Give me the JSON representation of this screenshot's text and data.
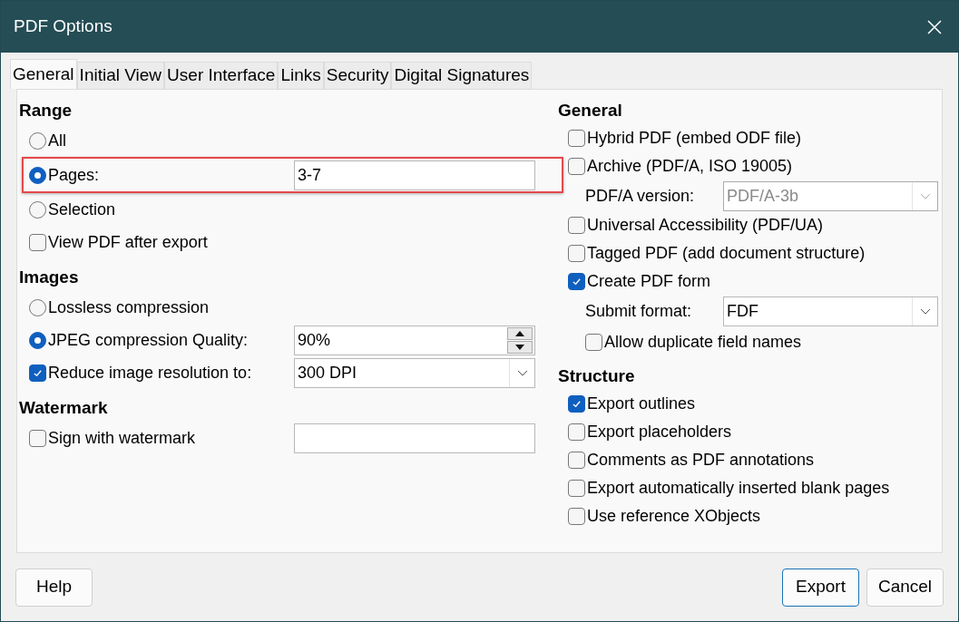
{
  "window": {
    "title": "PDF Options"
  },
  "tabs": [
    {
      "label": "General",
      "selected": true
    },
    {
      "label": "Initial View",
      "selected": false
    },
    {
      "label": "User Interface",
      "selected": false
    },
    {
      "label": "Links",
      "selected": false
    },
    {
      "label": "Security",
      "selected": false
    },
    {
      "label": "Digital Signatures",
      "selected": false
    }
  ],
  "left_sections": [
    {
      "heading": "Range",
      "items": [
        {
          "kind": "radio",
          "label": "All",
          "selected": false,
          "highlighted": false
        },
        {
          "kind": "radio",
          "label": "Pages:",
          "selected": true,
          "highlighted": true,
          "field": {
            "kind": "text",
            "value": "3-7",
            "disabled": false
          }
        },
        {
          "kind": "radio",
          "label": "Selection",
          "selected": false,
          "highlighted": false
        },
        {
          "kind": "checkbox",
          "label": "View PDF after export",
          "checked": false,
          "highlighted": false
        }
      ]
    },
    {
      "heading": "Images",
      "items": [
        {
          "kind": "radio",
          "label": "Lossless compression",
          "selected": false,
          "highlighted": false
        },
        {
          "kind": "radio",
          "label": "JPEG compression Quality:",
          "selected": true,
          "highlighted": false,
          "field": {
            "kind": "spin",
            "value": "90%",
            "disabled": false
          }
        },
        {
          "kind": "checkbox",
          "label": "Reduce image resolution to:",
          "checked": true,
          "highlighted": false,
          "field": {
            "kind": "select",
            "value": "300 DPI",
            "disabled": false
          }
        }
      ]
    },
    {
      "heading": "Watermark",
      "items": [
        {
          "kind": "checkbox",
          "label": "Sign with watermark",
          "checked": false,
          "highlighted": false,
          "field": {
            "kind": "text",
            "disabled": false
          }
        }
      ]
    }
  ],
  "right_sections": [
    {
      "heading": "General",
      "items": [
        {
          "kind": "checkbox",
          "label": "Hybrid PDF (embed ODF file)",
          "checked": false
        },
        {
          "kind": "checkbox",
          "label": "Archive (PDF/A, ISO 19005)",
          "checked": false,
          "children": [
            {
              "kind": "label",
              "label": "PDF/A version:",
              "field": {
                "kind": "select",
                "value": "PDF/A-3b",
                "disabled": true
              }
            }
          ]
        },
        {
          "kind": "checkbox",
          "label": "Universal Accessibility (PDF/UA)",
          "checked": false
        },
        {
          "kind": "checkbox",
          "label": "Tagged PDF (add document structure)",
          "checked": false
        },
        {
          "kind": "checkbox",
          "label": "Create PDF form",
          "checked": true,
          "children": [
            {
              "kind": "label",
              "label": "Submit format:",
              "field": {
                "kind": "select",
                "value": "FDF",
                "disabled": false
              }
            },
            {
              "kind": "checkbox",
              "label": "Allow duplicate field names",
              "checked": false
            }
          ]
        }
      ]
    },
    {
      "heading": "Structure",
      "items": [
        {
          "kind": "checkbox",
          "label": "Export outlines",
          "checked": true
        },
        {
          "kind": "checkbox",
          "label": "Export placeholders",
          "checked": false
        },
        {
          "kind": "checkbox",
          "label": "Comments as PDF annotations",
          "checked": false
        },
        {
          "kind": "checkbox",
          "label": "Export automatically inserted blank pages",
          "checked": false
        },
        {
          "kind": "checkbox",
          "label": "Use reference XObjects",
          "checked": false
        }
      ]
    }
  ],
  "buttons": [
    {
      "label": "Help",
      "kind": "help",
      "default": false
    },
    {
      "label": "Export",
      "kind": "action",
      "default": true
    },
    {
      "label": "Cancel",
      "kind": "action",
      "default": false
    }
  ]
}
